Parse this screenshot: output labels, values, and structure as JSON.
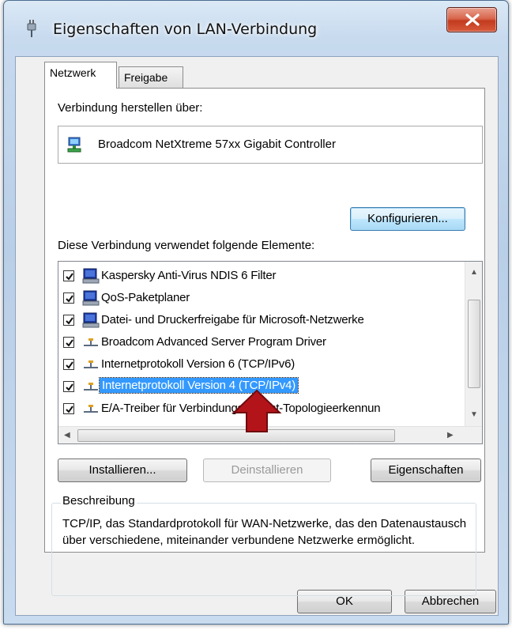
{
  "window": {
    "title": "Eigenschaften von LAN-Verbindung",
    "close_glyph": "X"
  },
  "tabs": [
    {
      "label": "Netzwerk",
      "active": true
    },
    {
      "label": "Freigabe",
      "active": false
    }
  ],
  "connection": {
    "label": "Verbindung herstellen über:",
    "adapter": "Broadcom NetXtreme 57xx Gigabit Controller",
    "adapter_icon": "network-adapter-icon",
    "configure_button": "Konfigurieren..."
  },
  "elements": {
    "label": "Diese Verbindung verwendet folgende Elemente:",
    "items": [
      {
        "label": "Kaspersky Anti-Virus NDIS 6 Filter",
        "checked": true,
        "icon": "service-monitor-icon",
        "selected": false
      },
      {
        "label": "QoS-Paketplaner",
        "checked": true,
        "icon": "service-monitor-icon",
        "selected": false
      },
      {
        "label": "Datei- und Druckerfreigabe für Microsoft-Netzwerke",
        "checked": true,
        "icon": "service-monitor-icon",
        "selected": false
      },
      {
        "label": "Broadcom Advanced Server Program Driver",
        "checked": true,
        "icon": "protocol-icon",
        "selected": false
      },
      {
        "label": "Internetprotokoll Version 6 (TCP/IPv6)",
        "checked": true,
        "icon": "protocol-icon",
        "selected": false
      },
      {
        "label": "Internetprotokoll Version 4 (TCP/IPv4)",
        "checked": true,
        "icon": "protocol-icon",
        "selected": true
      },
      {
        "label": "E/A-Treiber für Verbindungsschicht-Topologieerkennun",
        "checked": true,
        "icon": "protocol-icon",
        "selected": false
      }
    ]
  },
  "actions": {
    "install": "Installieren...",
    "uninstall": "Deinstallieren",
    "properties": "Eigenschaften"
  },
  "description": {
    "label": "Beschreibung",
    "text": "TCP/IP, das Standardprotokoll für WAN-Netzwerke, das den Datenaustausch über verschiedene, miteinander verbundene Netzwerke ermöglicht."
  },
  "footer": {
    "ok": "OK",
    "cancel": "Abbrechen"
  },
  "colors": {
    "selection": "#3399ff",
    "annotation_arrow": "#b3141a"
  }
}
